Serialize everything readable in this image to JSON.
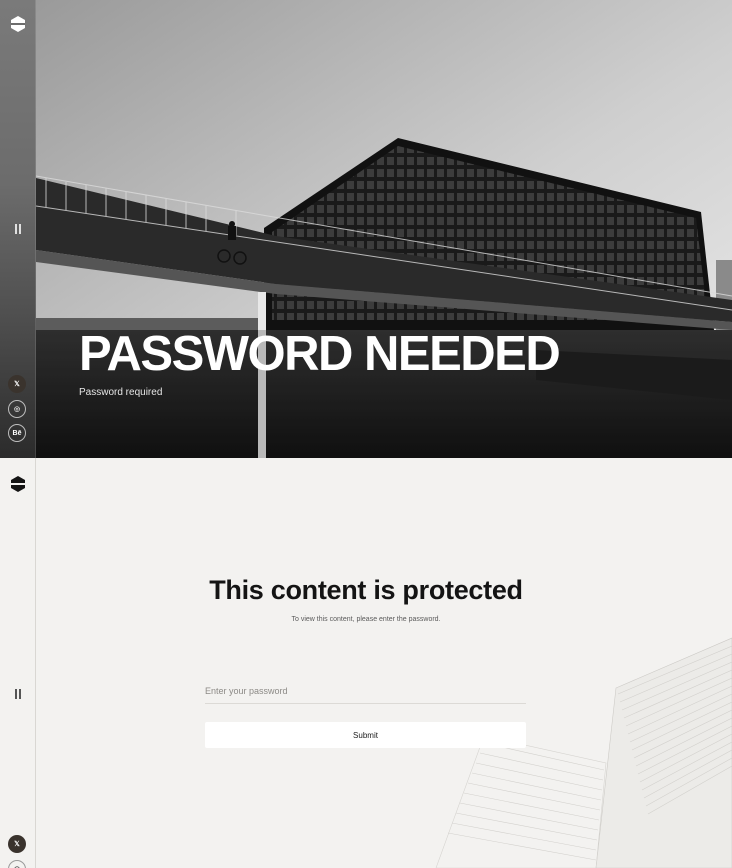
{
  "hero": {
    "title": "PASSWORD NEEDED",
    "subtitle": "Password required"
  },
  "sidebar": {
    "logo_icon": "hexagon-logo-icon",
    "pause_icon": "pause-icon",
    "social": [
      {
        "name": "x-icon",
        "label": "𝕏"
      },
      {
        "name": "dribbble-icon",
        "label": "◎"
      },
      {
        "name": "behance-icon",
        "label": "Bē"
      }
    ]
  },
  "protected": {
    "title": "This content is protected",
    "description": "To view this content, please enter the password.",
    "password_placeholder": "Enter your password",
    "password_value": "",
    "submit_label": "Submit"
  },
  "colors": {
    "background": "#f3f2f0",
    "text": "#141414",
    "button": "#ffffff",
    "social_dark": "#3a332d"
  }
}
